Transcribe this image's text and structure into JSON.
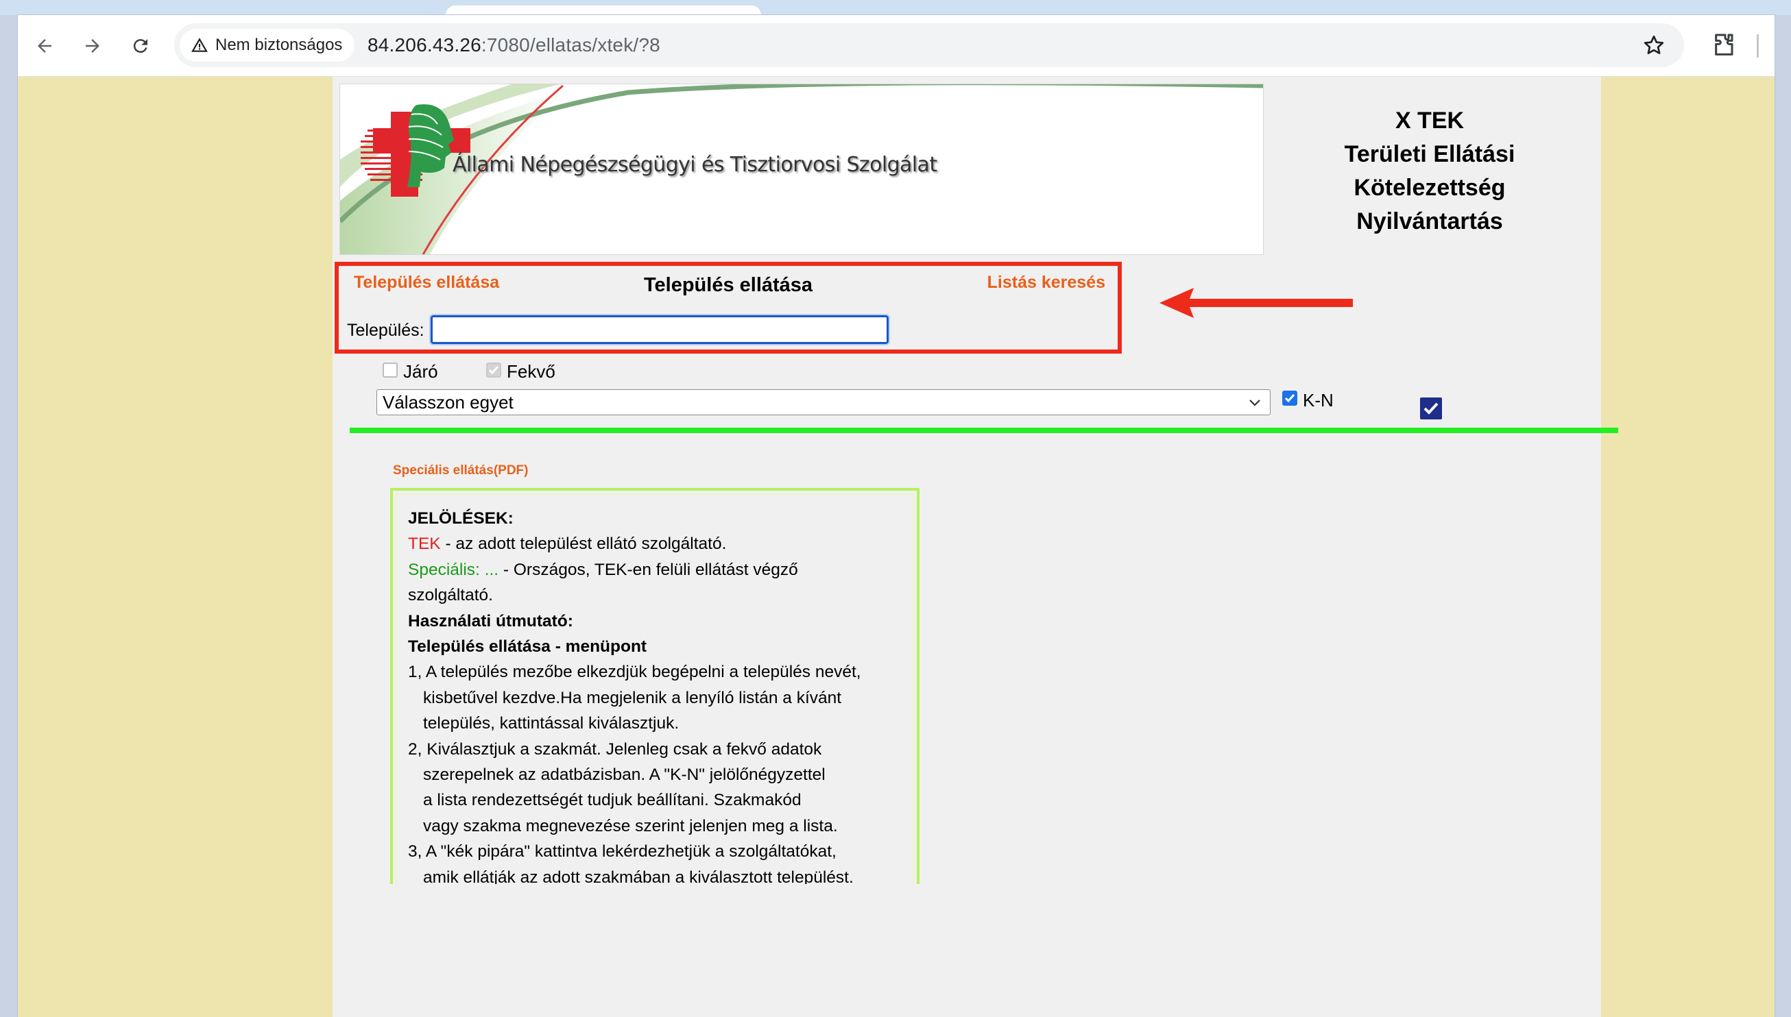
{
  "browser": {
    "security_chip": "Nem biztonságos",
    "url_host": "84.206.43.26",
    "url_rest": ":7080/ellatas/xtek/?8",
    "icons": [
      "back-icon",
      "forward-icon",
      "reload-icon",
      "warning-icon",
      "star-icon",
      "extensions-icon"
    ]
  },
  "banner": {
    "org_name": "Állami Népegészségügyi és Tisztiorvosi Szolgálat"
  },
  "title": {
    "line1": "X TEK",
    "line2": "Területi Ellátási",
    "line3": "Kötelezettség",
    "line4": "Nyilvántartás"
  },
  "nav": {
    "left_link": "Település ellátása",
    "center_title": "Település ellátása",
    "right_link": "Listás keresés"
  },
  "search": {
    "label": "Település:",
    "value": ""
  },
  "filters": {
    "jaro_label": "Járó",
    "jaro_checked": false,
    "fekvo_label": "Fekvő",
    "fekvo_checked": true,
    "select_value": "Válasszon egyet",
    "kn_label": "K-N",
    "kn_checked": true
  },
  "special_link": "Speciális ellátás(PDF)",
  "legend": {
    "heading": "JELÖLÉSEK:",
    "tek_tag": "TEK",
    "tek_text": " - az adott települést ellátó szolgáltató.",
    "spec_tag": "Speciális: ...",
    "spec_text": " - Országos, TEK-en felüli ellátást végző",
    "spec_text2": "szolgáltató.",
    "usage_heading": "Használati útmutató:",
    "menu_heading": "Település ellátása - menüpont",
    "step1_a": "1, A település mezőbe elkezdjük begépelni a település nevét,",
    "step1_b": "kisbetűvel kezdve.Ha megjelenik a lenyíló listán a kívánt",
    "step1_c": "település, kattintással kiválasztjuk.",
    "step2_a": "2, Kiválasztjuk a szakmát. Jelenleg csak a fekvő adatok",
    "step2_b": "szerepelnek az adatbázisban. A \"K-N\" jelölőnégyzettel",
    "step2_c": "a lista rendezettségét tudjuk beállítani. Szakmakód",
    "step2_d": "vagy szakma megnevezése szerint jelenjen meg a lista.",
    "step3_a": "3, A \"kék pipára\" kattintva lekérdezhetjük a szolgáltatókat,",
    "step3_b": "amik ellátják az adott szakmában a kiválasztott települést."
  }
}
